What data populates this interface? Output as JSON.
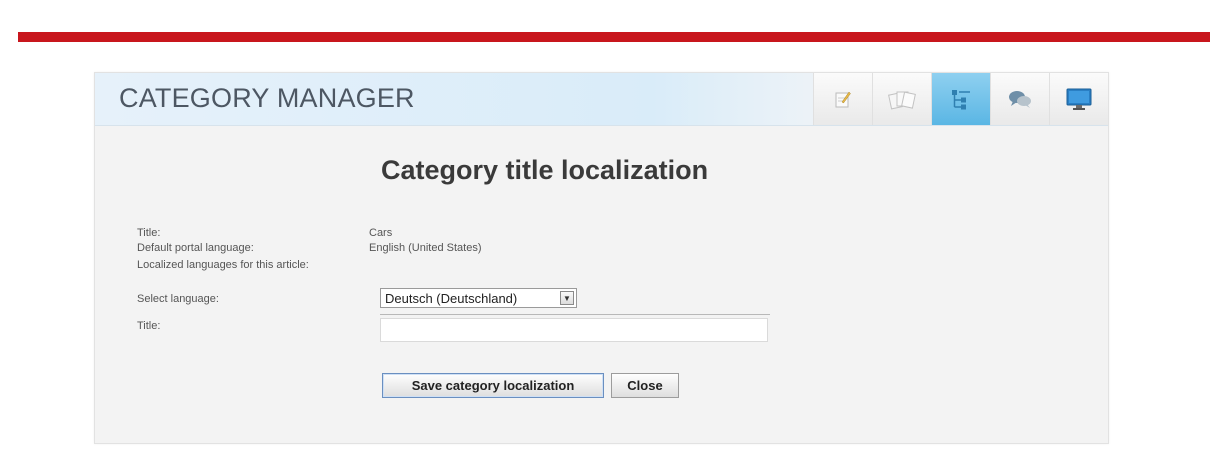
{
  "header": {
    "title": "CATEGORY MANAGER",
    "icons": [
      "edit-icon",
      "articles-icon",
      "category-tree-icon",
      "comments-icon",
      "monitor-icon"
    ],
    "active_icon": "category-tree-icon",
    "accent_color": "#c8161d"
  },
  "form": {
    "heading": "Category title localization",
    "fields": {
      "title_label": "Title:",
      "title_value": "Cars",
      "default_language_label": "Default portal language:",
      "default_language_value": "English (United States)",
      "localized_languages_label": "Localized languages for this article:",
      "select_language_label": "Select language:",
      "selected_language": "Deutsch (Deutschland)",
      "localized_title_label": "Title:",
      "localized_title_value": ""
    },
    "buttons": {
      "save": "Save category localization",
      "close": "Close"
    }
  }
}
